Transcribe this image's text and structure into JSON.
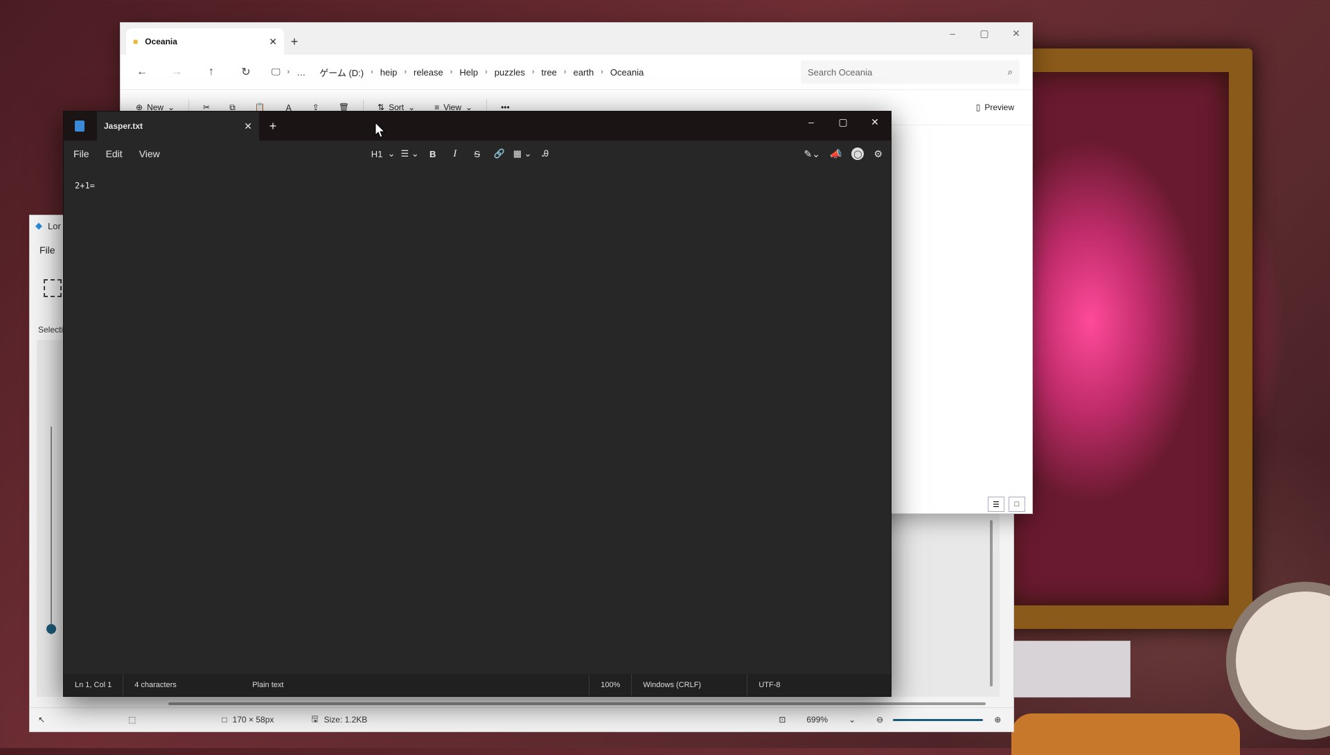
{
  "explorer": {
    "tab_title": "Oceania",
    "tab_close": "✕",
    "new_tab": "+",
    "window_controls": [
      "–",
      "▢",
      "✕"
    ],
    "nav": {
      "back": "←",
      "forward": "→",
      "up": "↑",
      "refresh": "↻"
    },
    "breadcrumbs": [
      "…",
      "ゲーム (D:)",
      "heip",
      "release",
      "Help",
      "puzzles",
      "tree",
      "earth",
      "Oceania"
    ],
    "search_placeholder": "Search Oceania",
    "commands": {
      "new": "New",
      "sort": "Sort",
      "view": "View",
      "more": "•••",
      "preview": "Preview"
    }
  },
  "notepad": {
    "tab_title": "Jasper.txt",
    "tab_close": "✕",
    "new_tab": "+",
    "window_controls": [
      "–",
      "▢",
      "✕"
    ],
    "menus": [
      "File",
      "Edit",
      "View"
    ],
    "format": {
      "heading": "H1",
      "bold": "B",
      "italic": "I",
      "strike": "S"
    },
    "content": "2+1=",
    "status": {
      "position": "Ln 1, Col 1",
      "chars": "4 characters",
      "type": "Plain text",
      "zoom": "100%",
      "line_ending": "Windows (CRLF)",
      "encoding": "UTF-8"
    }
  },
  "paint": {
    "title": "Lor",
    "menu_file": "File",
    "selection_label": "Selectio",
    "status": {
      "dimensions": "170 × 58px",
      "size": "Size: 1.2KB",
      "zoom": "699%"
    }
  },
  "colors": {
    "notepad_bg": "#272727",
    "explorer_bg": "#ffffff",
    "accent": "#1a5a7a"
  }
}
